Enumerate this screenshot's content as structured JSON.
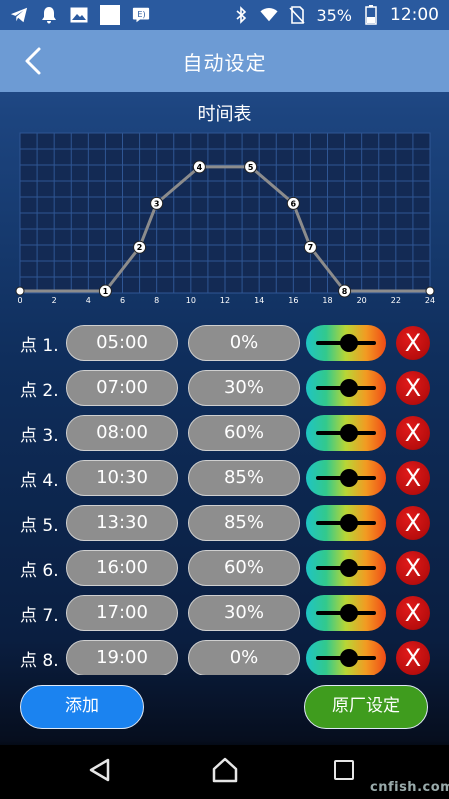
{
  "status_bar": {
    "battery_percent": "35%",
    "time": "12:00",
    "icons": [
      "telegram-icon",
      "notification-bell-icon",
      "image-icon",
      "blank-app-icon",
      "message-icon",
      "bluetooth-icon",
      "wifi-icon",
      "no-sim-icon",
      "battery-icon"
    ]
  },
  "header": {
    "title": "自动设定",
    "back_icon": "chevron-left-icon"
  },
  "chart": {
    "title": "时间表"
  },
  "chart_data": {
    "type": "line",
    "title": "时间表",
    "xlabel": "",
    "ylabel": "",
    "xlim": [
      0,
      24
    ],
    "ylim": [
      0,
      100
    ],
    "x_ticks": [
      0,
      2,
      4,
      6,
      8,
      10,
      12,
      14,
      16,
      18,
      20,
      22,
      24
    ],
    "grid": true,
    "line_color": "#8c8c8c",
    "points": [
      {
        "label": "",
        "x": 0,
        "y": 0
      },
      {
        "label": "1",
        "x": 5,
        "y": 0
      },
      {
        "label": "2",
        "x": 7,
        "y": 30
      },
      {
        "label": "3",
        "x": 8,
        "y": 60
      },
      {
        "label": "4",
        "x": 10.5,
        "y": 85
      },
      {
        "label": "5",
        "x": 13.5,
        "y": 85
      },
      {
        "label": "6",
        "x": 16,
        "y": 60
      },
      {
        "label": "7",
        "x": 17,
        "y": 30
      },
      {
        "label": "8",
        "x": 19,
        "y": 0
      },
      {
        "label": "",
        "x": 24,
        "y": 0
      }
    ]
  },
  "points_list": [
    {
      "label": "点 1.",
      "time": "05:00",
      "percent": "0%"
    },
    {
      "label": "点 2.",
      "time": "07:00",
      "percent": "30%"
    },
    {
      "label": "点 3.",
      "time": "08:00",
      "percent": "60%"
    },
    {
      "label": "点 4.",
      "time": "10:30",
      "percent": "85%"
    },
    {
      "label": "点 5.",
      "time": "13:30",
      "percent": "85%"
    },
    {
      "label": "点 6.",
      "time": "16:00",
      "percent": "60%"
    },
    {
      "label": "点 7.",
      "time": "17:00",
      "percent": "30%"
    },
    {
      "label": "点 8.",
      "time": "19:00",
      "percent": "0%"
    }
  ],
  "row_icons": {
    "color_slider": "color-slider-icon",
    "delete": "delete-icon",
    "delete_glyph": "X"
  },
  "actions": {
    "add_label": "添加",
    "factory_reset_label": "原厂设定"
  },
  "colors": {
    "add_button": "#1b83f0",
    "factory_button": "#3f9c1e",
    "delete_button": "#c81010",
    "header": "#6d9bd4"
  },
  "watermark": "cnfish.com"
}
